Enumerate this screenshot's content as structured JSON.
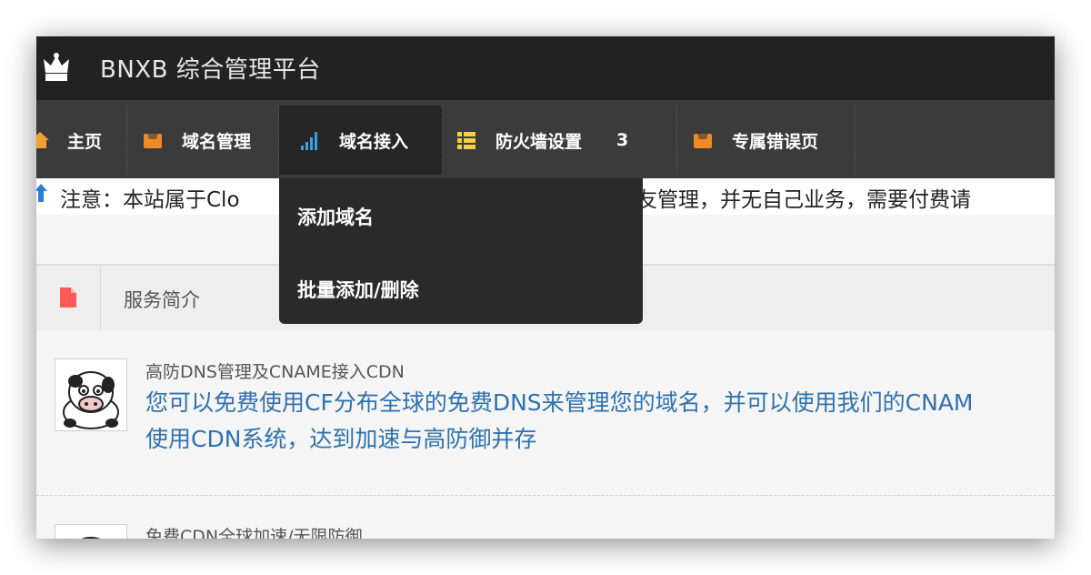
{
  "app": {
    "title": "BNXB 综合管理平台",
    "logo_icon": "crown-icon"
  },
  "nav": {
    "items": [
      {
        "label": "主页",
        "icon": "home-icon"
      },
      {
        "label": "域名管理",
        "icon": "package-icon"
      },
      {
        "label": "域名接入",
        "icon": "signal-icon",
        "active": true
      },
      {
        "label": "防火墙设置",
        "icon": "list-icon",
        "badge": "3"
      },
      {
        "label": "专属错误页",
        "icon": "package-icon"
      }
    ],
    "dropdown": [
      "添加域名",
      "批量添加/删除"
    ]
  },
  "notice": {
    "text": "注意：本站属于Clo",
    "text_after": "网友管理，并无自己业务，需要付费请"
  },
  "section": {
    "title": "服务简介",
    "icon": "file-icon"
  },
  "services": [
    {
      "title": "高防DNS管理及CNAME接入CDN",
      "desc_line1": "您可以免费使用CF分布全球的免费DNS来管理您的域名，并可以使用我们的CNAM",
      "desc_line2": "使用CDN系统，达到加速与高防御并存"
    },
    {
      "title": "免费CDN全球加速/无限防御"
    }
  ],
  "colors": {
    "topbar": "#222222",
    "nav": "#3b3b3b",
    "accent_link": "#2f72ad",
    "icon_orange": "#f08a24"
  }
}
